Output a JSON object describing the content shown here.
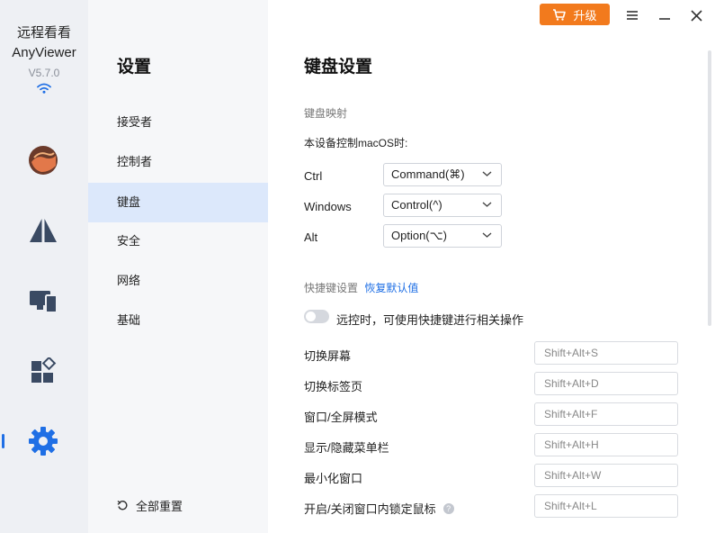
{
  "app": {
    "name_cn": "远程看看",
    "name_en": "AnyViewer",
    "version": "V5.7.0"
  },
  "topbar": {
    "upgrade_label": "升级"
  },
  "nav": {
    "title": "设置",
    "items": [
      {
        "label": "接受者"
      },
      {
        "label": "控制者"
      },
      {
        "label": "键盘"
      },
      {
        "label": "安全"
      },
      {
        "label": "网络"
      },
      {
        "label": "基础"
      }
    ],
    "active_index": 2,
    "reset_all": "全部重置"
  },
  "main": {
    "title": "键盘设置",
    "mapping": {
      "section_label": "键盘映射",
      "description": "本设备控制macOS时:",
      "rows": [
        {
          "key": "Ctrl",
          "value": "Command(⌘)"
        },
        {
          "key": "Windows",
          "value": "Control(^)"
        },
        {
          "key": "Alt",
          "value": "Option(⌥)"
        }
      ]
    },
    "shortcuts": {
      "section_label": "快捷键设置",
      "restore_link": "恢复默认值",
      "toggle_label": "远控时，可使用快捷键进行相关操作",
      "toggle_on": false,
      "rows": [
        {
          "label": "切换屏幕",
          "shortcut": "Shift+Alt+S"
        },
        {
          "label": "切换标签页",
          "shortcut": "Shift+Alt+D"
        },
        {
          "label": "窗口/全屏模式",
          "shortcut": "Shift+Alt+F"
        },
        {
          "label": "显示/隐藏菜单栏",
          "shortcut": "Shift+Alt+H"
        },
        {
          "label": "最小化窗口",
          "shortcut": "Shift+Alt+W"
        },
        {
          "label": "开启/关闭窗口内锁定鼠标",
          "shortcut": "Shift+Alt+L"
        }
      ]
    }
  },
  "colors": {
    "accent": "#1f6fe5",
    "upgrade": "#f27a1d",
    "rail_bg": "#eef0f4",
    "nav_bg": "#f6f7f9",
    "nav_active_bg": "#dce8fb"
  },
  "icons": {
    "rail": [
      "avatar",
      "triangle-logo-icon",
      "devices-icon",
      "apps-icon",
      "gear-icon"
    ],
    "window": [
      "menu-icon",
      "minimize-icon",
      "close-icon"
    ]
  }
}
